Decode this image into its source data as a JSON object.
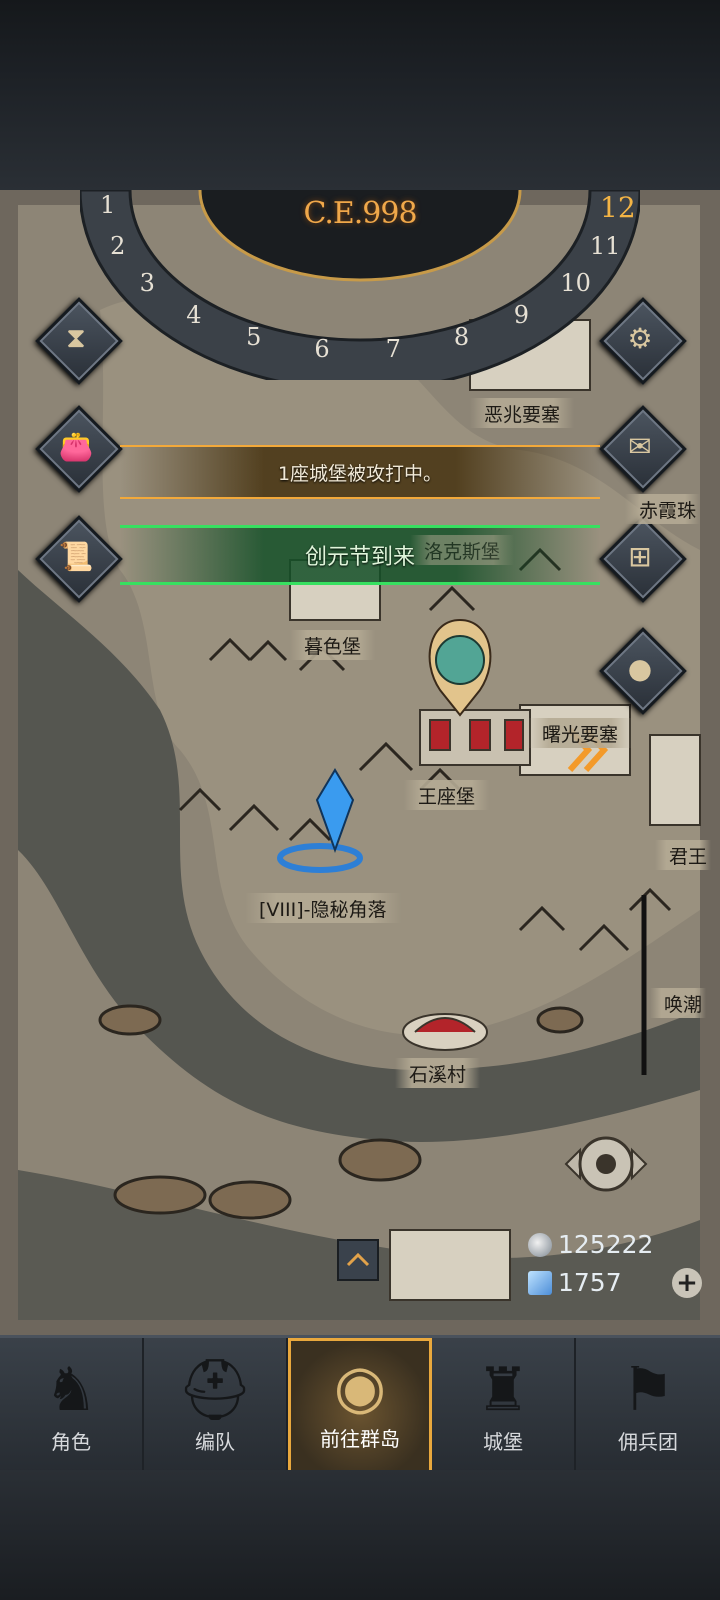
{
  "era": "C.E.998",
  "dial_numbers": [
    "1",
    "2",
    "3",
    "4",
    "5",
    "6",
    "7",
    "8",
    "9",
    "10",
    "11",
    "12"
  ],
  "dial_current": "12",
  "side_buttons_left": [
    {
      "name": "hourglass-icon",
      "glyph": "⧗"
    },
    {
      "name": "money-bag-icon",
      "glyph": "👛"
    },
    {
      "name": "scroll-map-icon",
      "glyph": "📜"
    }
  ],
  "side_buttons_right": [
    {
      "name": "settings-gear-icon",
      "glyph": "⚙"
    },
    {
      "name": "mail-icon",
      "glyph": "✉"
    },
    {
      "name": "frame-icon",
      "glyph": "⊞"
    },
    {
      "name": "coin-icon",
      "glyph": "●"
    }
  ],
  "notices": {
    "attack": "1座城堡被攻打中。",
    "festival": "创元节到来"
  },
  "locations": {
    "fortress_ominous": "恶兆要塞",
    "red_cloud": "赤霞珠",
    "losas_castle": "洛克斯堡",
    "dusk_castle": "暮色堡",
    "dawn_fortress": "曙光要塞",
    "throne_castle": "王座堡",
    "king": "君王",
    "hidden_corner": "[VIII]-隐秘角落",
    "tide_call": "唤潮",
    "stone_creek": "石溪村"
  },
  "resources": {
    "silver": "125222",
    "crystal": "1757"
  },
  "nav": [
    {
      "label": "角色",
      "icon": "knight-icon",
      "glyph": "♞"
    },
    {
      "label": "编队",
      "icon": "helmet-icon",
      "glyph": "⛑"
    },
    {
      "label": "前往群岛",
      "icon": "world-map-icon",
      "glyph": "◉"
    },
    {
      "label": "城堡",
      "icon": "castle-icon",
      "glyph": "♜"
    },
    {
      "label": "佣兵团",
      "icon": "banner-icon",
      "glyph": "⚑"
    }
  ],
  "colors": {
    "accent_orange": "#f3a93a",
    "accent_green": "#37e060",
    "map_parchment": "#8a8173"
  }
}
